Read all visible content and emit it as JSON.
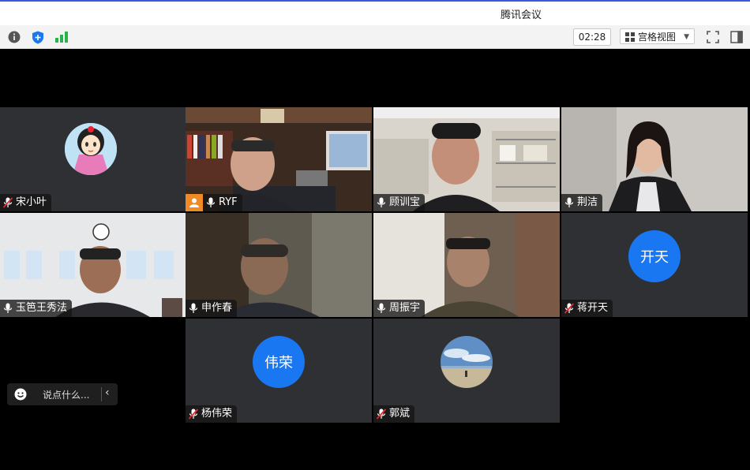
{
  "window": {
    "title": "腾讯会议"
  },
  "toolbar": {
    "info_icon": "info-icon",
    "security_icon": "shield-icon",
    "signal_icon": "signal-icon",
    "timer": "02:28",
    "view_label": "宫格视图",
    "fullscreen_icon": "fullscreen-icon",
    "sidebar_icon": "sidebar-icon"
  },
  "participants": [
    {
      "name": "宋小叶",
      "mic": "muted",
      "type": "avatar-cartoon"
    },
    {
      "name": "RYF",
      "mic": "on",
      "type": "video",
      "host_badge": true
    },
    {
      "name": "顾训宝",
      "mic": "on",
      "type": "video"
    },
    {
      "name": "荆洁",
      "mic": "on",
      "type": "video"
    },
    {
      "name": "玉笆王秀法",
      "mic": "on",
      "type": "video"
    },
    {
      "name": "申作春",
      "mic": "on",
      "type": "video"
    },
    {
      "name": "周振宇",
      "mic": "on",
      "type": "video"
    },
    {
      "name": "蒋开天",
      "mic": "muted",
      "type": "initials",
      "initials": "开天"
    },
    {
      "name": "杨伟荣",
      "mic": "muted",
      "type": "initials",
      "initials": "伟荣"
    },
    {
      "name": "郭斌",
      "mic": "muted",
      "type": "avatar-photo"
    }
  ],
  "chat": {
    "placeholder": "说点什么..."
  },
  "colors": {
    "accent": "#1a77f2",
    "tile_bg": "#2e3033",
    "active_speaker": "#3fbf5f"
  }
}
